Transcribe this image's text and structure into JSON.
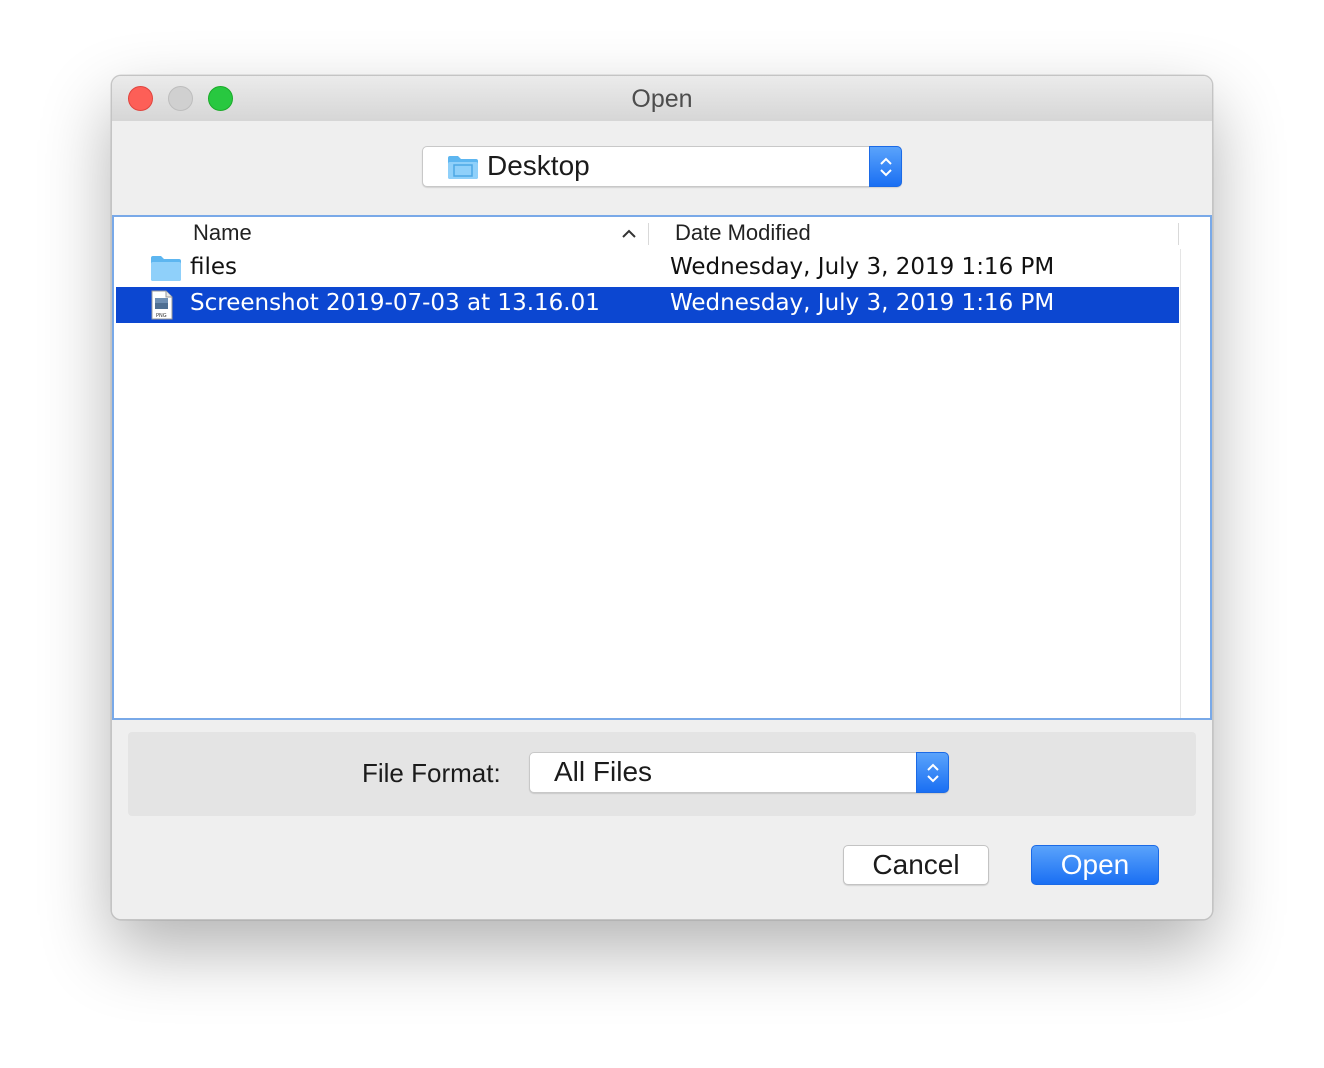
{
  "window": {
    "title": "Open"
  },
  "location": {
    "selected": "Desktop",
    "icon": "folder-icon"
  },
  "columns": {
    "name": "Name",
    "date_modified": "Date Modified",
    "sort": "ascending"
  },
  "files": [
    {
      "name": "files",
      "date": "Wednesday, July 3, 2019 1:16 PM",
      "icon": "folder-icon",
      "selected": false
    },
    {
      "name": "Screenshot 2019-07-03 at 13.16.01",
      "date": "Wednesday, July 3, 2019 1:16 PM",
      "icon": "png-file-icon",
      "selected": true
    }
  ],
  "file_format": {
    "label": "File Format:",
    "selected": "All Files"
  },
  "buttons": {
    "cancel": "Cancel",
    "open": "Open"
  },
  "colors": {
    "selection": "#0c47d1",
    "accent": "#1a6ff3",
    "close": "#fd5f57",
    "zoom": "#28c840"
  }
}
